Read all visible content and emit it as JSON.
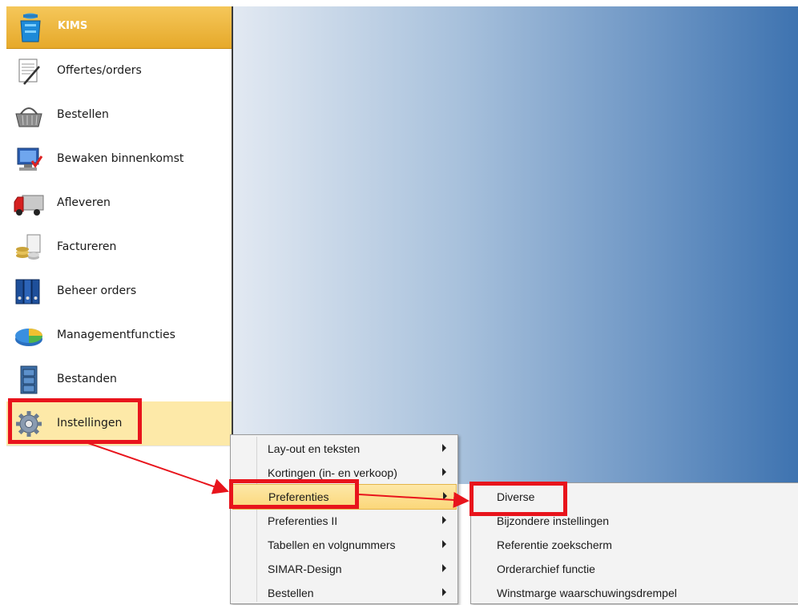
{
  "sidebar": {
    "header": {
      "title": "KIMS",
      "icon": "kims-bin-icon"
    },
    "items": [
      {
        "label": "Offertes/orders",
        "icon": "document-pen-icon"
      },
      {
        "label": "Bestellen",
        "icon": "shopping-basket-icon"
      },
      {
        "label": "Bewaken binnenkomst",
        "icon": "monitor-check-icon"
      },
      {
        "label": "Afleveren",
        "icon": "truck-icon"
      },
      {
        "label": "Factureren",
        "icon": "coins-icon"
      },
      {
        "label": "Beheer orders",
        "icon": "binders-icon"
      },
      {
        "label": "Managementfuncties",
        "icon": "pie-chart-icon"
      },
      {
        "label": "Bestanden",
        "icon": "file-cabinet-icon"
      },
      {
        "label": "Instellingen",
        "icon": "gear-icon",
        "selected": true
      }
    ]
  },
  "menu": {
    "items": [
      {
        "label": "Lay-out en teksten",
        "has_submenu": true
      },
      {
        "label": "Kortingen (in- en verkoop)",
        "has_submenu": true
      },
      {
        "label": "Preferenties",
        "has_submenu": true,
        "highlighted": true
      },
      {
        "label": "Preferenties II",
        "has_submenu": true
      },
      {
        "label": "Tabellen en volgnummers",
        "has_submenu": true
      },
      {
        "label": "SIMAR-Design",
        "has_submenu": true
      },
      {
        "label": "Bestellen",
        "has_submenu": true
      }
    ]
  },
  "submenu": {
    "items": [
      {
        "label": "Diverse"
      },
      {
        "label": "Bijzondere instellingen"
      },
      {
        "label": "Referentie zoekscherm"
      },
      {
        "label": "Orderarchief functie"
      },
      {
        "label": "Winstmarge waarschuwingsdrempel"
      }
    ]
  },
  "colors": {
    "header_gold": "#e6a92a",
    "selected_bg": "#fde9a8",
    "annotation_red": "#e8141c",
    "panel_blue": "#3e73b0"
  }
}
